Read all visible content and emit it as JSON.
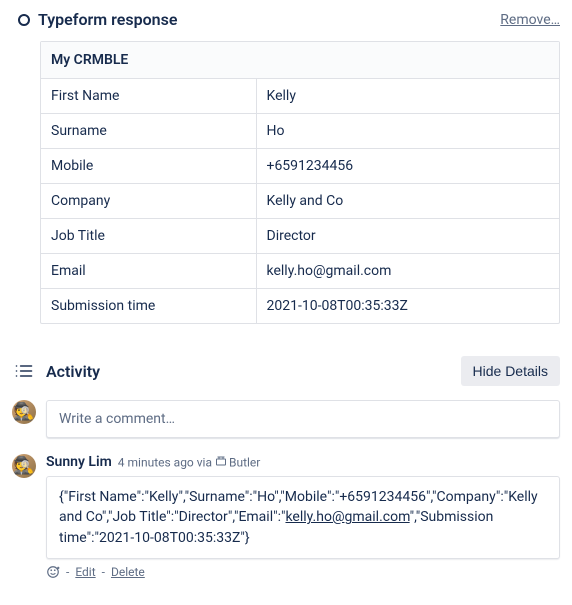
{
  "typeform": {
    "title": "Typeform response",
    "remove_label": "Remove…",
    "table_title": "My CRMBLE",
    "rows": [
      {
        "label": "First Name",
        "value": "Kelly"
      },
      {
        "label": "Surname",
        "value": "Ho"
      },
      {
        "label": "Mobile",
        "value": "+6591234456"
      },
      {
        "label": "Company",
        "value": "Kelly and Co"
      },
      {
        "label": "Job Title",
        "value": "Director"
      },
      {
        "label": "Email",
        "value": "kelly.ho@gmail.com"
      },
      {
        "label": "Submission time",
        "value": "2021-10-08T00:35:33Z"
      }
    ]
  },
  "activity": {
    "title": "Activity",
    "hide_details_label": "Hide Details",
    "comment_placeholder": "Write a comment…",
    "comment": {
      "author": "Sunny Lim",
      "time_prefix": "4 minutes ago via ",
      "via": "Butler",
      "body_prefix": "{\"First Name\":\"Kelly\",\"Surname\":\"Ho\",\"Mobile\":\"+6591234456\",\"Company\":\"Kelly and Co\",\"Job Title\":\"Director\",\"Email\":\"",
      "body_link": "kelly.ho@gmail.com",
      "body_suffix": "\",\"Submission time\":\"2021-10-08T00:35:33Z\"}",
      "edit_label": "Edit",
      "delete_label": "Delete",
      "sep": " - "
    }
  }
}
